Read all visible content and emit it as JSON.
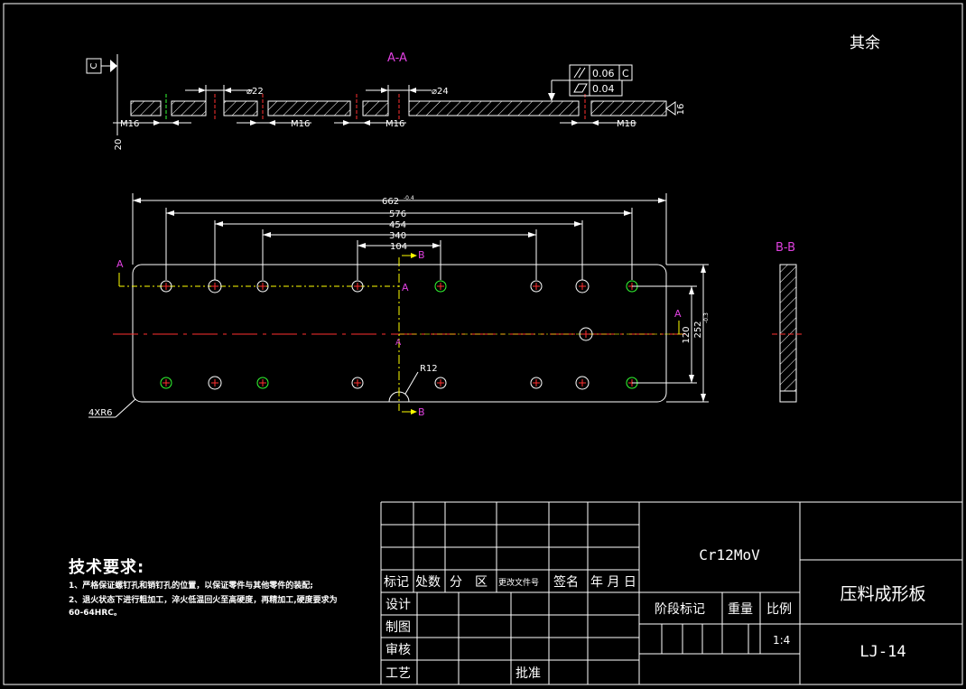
{
  "header": {
    "surface_note": "其余"
  },
  "section_aa": {
    "label": "A-A",
    "datum_label": "C",
    "dims": {
      "d22": "⌀22",
      "d24": "⌀24",
      "m16_a": "M16",
      "m16_b": "M16",
      "m16_c": "M16",
      "m18": "M18",
      "h20": "20",
      "t16": "16"
    },
    "tolerance": {
      "parallel_value": "0.06",
      "parallel_datum": "C",
      "flatness_value": "0.04"
    }
  },
  "plan": {
    "dims": {
      "overall": "662",
      "overall_tol": "-0.4",
      "d576": "576",
      "d454": "454",
      "d340": "340",
      "d104": "104",
      "h120": "120",
      "h252": "252",
      "h252_tol": "-0.3"
    },
    "labels": {
      "r12": "R12",
      "corner": "4XR6",
      "a": "A",
      "b": "B"
    }
  },
  "section_bb": {
    "label": "B-B"
  },
  "technical": {
    "title": "技术要求:",
    "line1": "1、严格保证螺钉孔和销钉孔的位置，以保证零件与其他零件的装配;",
    "line2": "2、退火状态下进行粗加工，淬火低温回火至高硬度，再精加工,硬度要求为60-64HRC。"
  },
  "title_block": {
    "material": "Cr12MoV",
    "part_name": "压料成形板",
    "drawing_no": "LJ-14",
    "revision_headers": [
      "标记",
      "处数",
      "分　区",
      "更改文件号",
      "签名",
      "年 月 日"
    ],
    "roles": [
      "设计",
      "制图",
      "审核",
      "工艺"
    ],
    "approve": "批准",
    "stage_mark": "阶段标记",
    "weight": "重量",
    "scale_label": "比例",
    "scale_value": "1:4"
  },
  "colors": {
    "line": "#ffffff",
    "accent": "#e040e0",
    "hidden": "#ff3030",
    "yellow": "#ffff00",
    "green": "#33ff33"
  }
}
